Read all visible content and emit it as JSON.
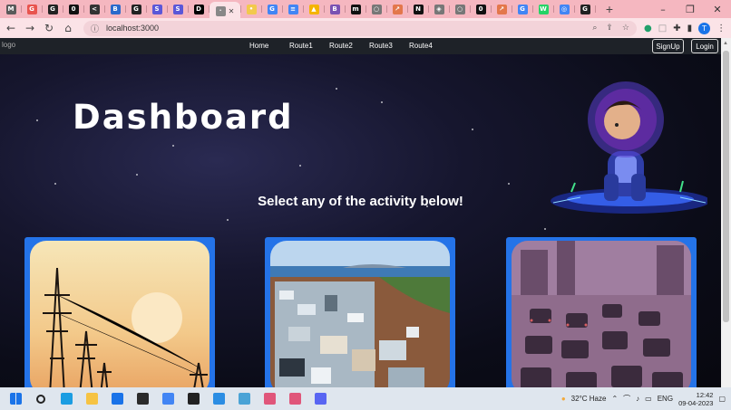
{
  "browser": {
    "tabs": [
      {
        "icon": "app-icon",
        "color": "#5a5a5a",
        "glyph": "M"
      },
      {
        "icon": "github-icon",
        "color": "#e8544e",
        "glyph": "G"
      },
      {
        "icon": "github-icon",
        "color": "#222222",
        "glyph": "G"
      },
      {
        "icon": "circle-icon",
        "color": "#111111",
        "glyph": "0"
      },
      {
        "icon": "chevron-icon",
        "color": "#333333",
        "glyph": "<"
      },
      {
        "icon": "book-icon",
        "color": "#2a6acb",
        "glyph": "B"
      },
      {
        "icon": "github-icon",
        "color": "#222222",
        "glyph": "G"
      },
      {
        "icon": "shield-icon",
        "color": "#5b57d8",
        "glyph": "S"
      },
      {
        "icon": "shield-icon",
        "color": "#5b57d8",
        "glyph": "S"
      },
      {
        "icon": "dev-icon",
        "color": "#000000",
        "glyph": "D"
      }
    ],
    "tabs_right": [
      {
        "icon": "bulb-icon",
        "color": "#f2c94c",
        "glyph": "•"
      },
      {
        "icon": "google-icon",
        "color": "#4285f4",
        "glyph": "G"
      },
      {
        "icon": "docs-icon",
        "color": "#4285f4",
        "glyph": "≡"
      },
      {
        "icon": "drive-icon",
        "color": "#f4b400",
        "glyph": "▲"
      },
      {
        "icon": "bootstrap-icon",
        "color": "#7952b3",
        "glyph": "B"
      },
      {
        "icon": "medium-icon",
        "color": "#111111",
        "glyph": "m"
      },
      {
        "icon": "globe-icon",
        "color": "#777777",
        "glyph": "○"
      },
      {
        "icon": "arrow-icon",
        "color": "#e3774b",
        "glyph": "↗"
      },
      {
        "icon": "notion-icon",
        "color": "#111111",
        "glyph": "N"
      },
      {
        "icon": "sync-icon",
        "color": "#777777",
        "glyph": "◈"
      },
      {
        "icon": "globe-icon",
        "color": "#777777",
        "glyph": "○"
      },
      {
        "icon": "circle-icon",
        "color": "#111111",
        "glyph": "0"
      },
      {
        "icon": "arrow-icon",
        "color": "#e3774b",
        "glyph": "↗"
      },
      {
        "icon": "google-icon",
        "color": "#4285f4",
        "glyph": "G"
      },
      {
        "icon": "whatsapp-icon",
        "color": "#25d366",
        "glyph": "W"
      },
      {
        "icon": "chrome-icon",
        "color": "#4285f4",
        "glyph": "◎"
      },
      {
        "icon": "github-icon",
        "color": "#222222",
        "glyph": "G"
      }
    ],
    "new_tab_label": "+",
    "window_controls": {
      "minimize": "–",
      "restore": "❐",
      "close": "✕"
    },
    "url": "localhost:3000",
    "profile_initial": "T"
  },
  "page": {
    "logo_alt": "logo",
    "nav": [
      "Home",
      "Route1",
      "Route2",
      "Route3",
      "Route4"
    ],
    "signup_label": "SignUp",
    "login_label": "Login",
    "title": "Dashboard",
    "subtitle": "Select any of the activity below!",
    "cards": [
      {
        "topic": "power-lines-sunset"
      },
      {
        "topic": "plastic-waste"
      },
      {
        "topic": "traffic-jam"
      }
    ]
  },
  "taskbar": {
    "apps": [
      {
        "icon": "windows-start-icon",
        "color": "#1a73e8"
      },
      {
        "icon": "search-icon",
        "color": "#222222"
      },
      {
        "icon": "edge-icon",
        "color": "#1b9de2"
      },
      {
        "icon": "file-explorer-icon",
        "color": "#f6c343"
      },
      {
        "icon": "mail-icon",
        "color": "#1a73e8"
      },
      {
        "icon": "terminal-icon",
        "color": "#2b2b2b"
      },
      {
        "icon": "chrome-icon",
        "color": "#4285f4"
      },
      {
        "icon": "sticky-notes-icon",
        "color": "#222222"
      },
      {
        "icon": "vscode-icon",
        "color": "#2b8de3"
      },
      {
        "icon": "app-icon",
        "color": "#4aa3d6"
      },
      {
        "icon": "figma-icon",
        "color": "#e0567a"
      },
      {
        "icon": "figma-icon",
        "color": "#e0567a"
      },
      {
        "icon": "discord-icon",
        "color": "#5865f2"
      }
    ],
    "weather": "32°C  Haze",
    "language": "ENG",
    "time": "12:42",
    "date": "09-04-2023"
  }
}
